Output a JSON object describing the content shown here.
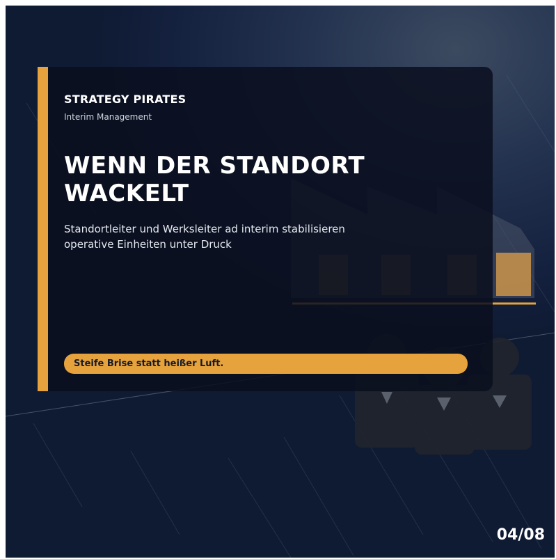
{
  "brand": {
    "name": "STRATEGY PIRATES",
    "subtitle": "Interim Management"
  },
  "slide": {
    "headline_line1": "WENN DER STANDORT",
    "headline_line2": "WACKELT",
    "subline_line1": "Standortleiter und Werksleiter ad interim stabilisieren",
    "subline_line2": "operative Einheiten unter Druck",
    "tagline": "Steife Brise statt heißer Luft.",
    "page_number": "04/08"
  },
  "colors": {
    "accent": "#e6a23c",
    "background": "#152240",
    "card": "#0a0f1e"
  },
  "icons": {
    "background_illustration": "factory-and-team-icon"
  }
}
